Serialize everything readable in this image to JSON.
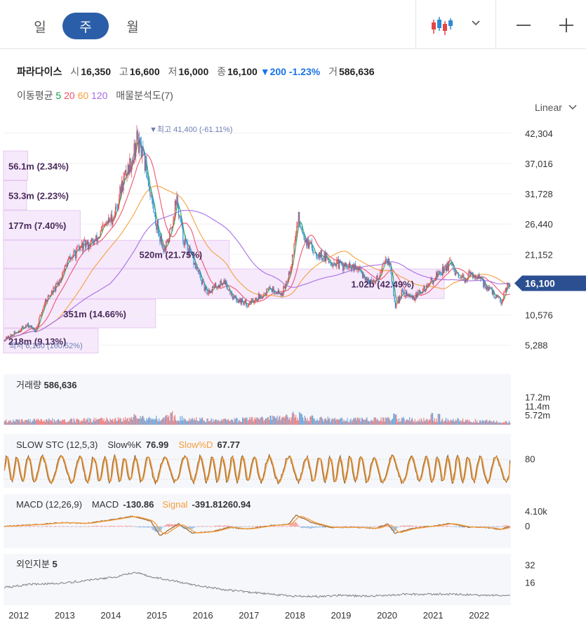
{
  "periods": {
    "day": "일",
    "week": "주",
    "month": "월"
  },
  "stock": {
    "name": "파라다이스",
    "open_label": "시",
    "open": "16,350",
    "high_label": "고",
    "high": "16,600",
    "low_label": "저",
    "low": "16,000",
    "close_label": "종",
    "close": "16,100",
    "change": "▼200",
    "change_pct": "-1.23%",
    "volume_label": "거",
    "volume": "586,636"
  },
  "ma_legend": {
    "label": "이동평균",
    "p5": "5",
    "p20": "20",
    "p60": "60",
    "p120": "120",
    "vp_label": "매물분석도(7)"
  },
  "scale_select": "Linear",
  "colors": {
    "up": "#e64545",
    "down": "#2d8bd4",
    "ma5": "#16a34a",
    "ma20": "#f0506e",
    "ma60": "#f59e3b",
    "ma120": "#a56be6",
    "accent": "#2b5ea8",
    "price_tag": "#2b4f91"
  },
  "icons": {
    "chart_type": "candlestick-icon",
    "dropdown": "chevron-down-icon",
    "zoom_out": "minus-icon",
    "zoom_in": "plus-icon"
  },
  "chart_data": [
    {
      "type": "candlestick",
      "y_ticks": [
        "42,304",
        "37,016",
        "31,728",
        "26,440",
        "21,152",
        "10,576",
        "5,288"
      ],
      "y_tick_values": [
        42304,
        37016,
        31728,
        26440,
        21152,
        10576,
        5288
      ],
      "ylim": [
        2800,
        43500
      ],
      "last_price": "16,100",
      "last_price_value": 16100,
      "annotations": {
        "high": "▼최고 41,400 (-61.11%)",
        "low": "최저 6,180 (160.52%)"
      },
      "volume_profile": [
        {
          "label": "218m (9.13%)",
          "price_from": 3800,
          "price_to": 8200,
          "pct": 9.13
        },
        {
          "label": "351m (14.66%)",
          "price_from": 8200,
          "price_to": 13300,
          "pct": 14.66
        },
        {
          "label": "1.02b (42.49%)",
          "price_from": 13300,
          "price_to": 18600,
          "pct": 42.49
        },
        {
          "label": "520m (21.75%)",
          "price_from": 18600,
          "price_to": 23600,
          "pct": 21.75
        },
        {
          "label": "177m (7.40%)",
          "price_from": 23600,
          "price_to": 28800,
          "pct": 7.4
        },
        {
          "label": "53.3m (2.23%)",
          "price_from": 28800,
          "price_to": 34000,
          "pct": 2.23
        },
        {
          "label": "56.1m (2.34%)",
          "price_from": 34000,
          "price_to": 39200,
          "pct": 2.34
        }
      ],
      "price_path": [
        [
          2011.7,
          6200
        ],
        [
          2011.95,
          7400
        ],
        [
          2012.2,
          8800
        ],
        [
          2012.4,
          7900
        ],
        [
          2012.6,
          13000
        ],
        [
          2012.85,
          15500
        ],
        [
          2013.1,
          20000
        ],
        [
          2013.4,
          22500
        ],
        [
          2013.7,
          23500
        ],
        [
          2013.9,
          26000
        ],
        [
          2014.1,
          28000
        ],
        [
          2014.3,
          34000
        ],
        [
          2014.5,
          38000
        ],
        [
          2014.6,
          41400
        ],
        [
          2014.8,
          36000
        ],
        [
          2015.0,
          27000
        ],
        [
          2015.2,
          21500
        ],
        [
          2015.35,
          26000
        ],
        [
          2015.45,
          31000
        ],
        [
          2015.6,
          24000
        ],
        [
          2015.9,
          18500
        ],
        [
          2016.1,
          14500
        ],
        [
          2016.3,
          15500
        ],
        [
          2016.5,
          16500
        ],
        [
          2016.7,
          13500
        ],
        [
          2017.0,
          12500
        ],
        [
          2017.3,
          14000
        ],
        [
          2017.5,
          15200
        ],
        [
          2017.75,
          14200
        ],
        [
          2017.95,
          19500
        ],
        [
          2018.1,
          27500
        ],
        [
          2018.3,
          23000
        ],
        [
          2018.5,
          21500
        ],
        [
          2018.8,
          20000
        ],
        [
          2019.1,
          19000
        ],
        [
          2019.4,
          18500
        ],
        [
          2019.7,
          16000
        ],
        [
          2019.9,
          18000
        ],
        [
          2020.0,
          21000
        ],
        [
          2020.1,
          19000
        ],
        [
          2020.2,
          12000
        ],
        [
          2020.35,
          14500
        ],
        [
          2020.6,
          13500
        ],
        [
          2020.9,
          15500
        ],
        [
          2021.1,
          17500
        ],
        [
          2021.4,
          19500
        ],
        [
          2021.6,
          16500
        ],
        [
          2021.9,
          17800
        ],
        [
          2022.2,
          15500
        ],
        [
          2022.5,
          12800
        ],
        [
          2022.65,
          16100
        ]
      ]
    },
    {
      "type": "bar",
      "title": "거래량",
      "value": "586,636",
      "y_ticks": [
        "17.2m",
        "11.4m",
        "5.72m"
      ],
      "y_tick_values": [
        17.2,
        11.4,
        5.72
      ],
      "ylim": [
        0,
        20
      ],
      "level": [
        [
          2011.7,
          0.25
        ],
        [
          2013.0,
          0.3
        ],
        [
          2014.3,
          0.38
        ],
        [
          2015.3,
          0.45
        ],
        [
          2016.5,
          0.28
        ],
        [
          2018.0,
          0.5
        ],
        [
          2019.0,
          0.32
        ],
        [
          2020.2,
          0.36
        ],
        [
          2021.2,
          0.33
        ],
        [
          2022.65,
          0.2
        ]
      ],
      "spikes": [
        [
          2014.55,
          0.75
        ],
        [
          2015.35,
          0.95
        ],
        [
          2018.0,
          0.85
        ],
        [
          2018.15,
          0.9
        ],
        [
          2020.2,
          0.7
        ],
        [
          2021.0,
          0.85
        ],
        [
          2021.15,
          0.7
        ]
      ]
    },
    {
      "type": "line",
      "title": "SLOW STC (12,5,3)",
      "k_label": "Slow%K",
      "k_value": "76.99",
      "d_label": "Slow%D",
      "d_value": "67.77",
      "y_ticks": [
        "80"
      ],
      "y_tick_values": [
        80
      ],
      "ylim": [
        0,
        100
      ]
    },
    {
      "type": "line",
      "title": "MACD (12,26,9)",
      "macd_label": "MACD",
      "macd_value": "-130.86",
      "signal_label": "Signal",
      "signal_value": "-391.81260.94",
      "y_ticks": [
        "4.10k",
        "0"
      ],
      "y_tick_values": [
        4100,
        0
      ],
      "ylim": [
        -5500,
        5500
      ],
      "macd_path": [
        [
          2011.7,
          0
        ],
        [
          2012.5,
          600
        ],
        [
          2013.0,
          1100
        ],
        [
          2013.5,
          900
        ],
        [
          2014.0,
          1800
        ],
        [
          2014.5,
          2900
        ],
        [
          2014.9,
          1500
        ],
        [
          2015.1,
          -2600
        ],
        [
          2015.3,
          -900
        ],
        [
          2015.5,
          800
        ],
        [
          2015.8,
          -1800
        ],
        [
          2016.2,
          -1500
        ],
        [
          2016.6,
          -200
        ],
        [
          2017.0,
          -700
        ],
        [
          2017.5,
          300
        ],
        [
          2017.9,
          700
        ],
        [
          2018.05,
          3200
        ],
        [
          2018.4,
          1100
        ],
        [
          2018.8,
          -300
        ],
        [
          2019.3,
          -200
        ],
        [
          2019.8,
          -500
        ],
        [
          2020.05,
          700
        ],
        [
          2020.2,
          -1900
        ],
        [
          2020.5,
          -700
        ],
        [
          2021.0,
          100
        ],
        [
          2021.4,
          900
        ],
        [
          2021.8,
          -200
        ],
        [
          2022.2,
          -300
        ],
        [
          2022.5,
          -800
        ],
        [
          2022.65,
          -130
        ]
      ]
    },
    {
      "type": "line",
      "title": "외인지분",
      "value": "5",
      "y_ticks": [
        "32",
        "16"
      ],
      "y_tick_values": [
        32,
        16
      ],
      "ylim": [
        -4,
        42
      ],
      "path": [
        [
          2011.7,
          12
        ],
        [
          2012.3,
          15
        ],
        [
          2013.0,
          16
        ],
        [
          2013.6,
          19
        ],
        [
          2014.2,
          22
        ],
        [
          2014.55,
          26
        ],
        [
          2014.9,
          22
        ],
        [
          2015.4,
          18
        ],
        [
          2015.9,
          14
        ],
        [
          2016.5,
          10
        ],
        [
          2017.0,
          8
        ],
        [
          2017.5,
          6
        ],
        [
          2018.0,
          4
        ],
        [
          2018.5,
          4
        ],
        [
          2019.0,
          5
        ],
        [
          2019.5,
          4
        ],
        [
          2020.0,
          5
        ],
        [
          2020.5,
          6
        ],
        [
          2021.0,
          6
        ],
        [
          2021.5,
          6
        ],
        [
          2022.0,
          5
        ],
        [
          2022.65,
          5
        ]
      ]
    }
  ],
  "x_axis": {
    "labels": [
      "2012",
      "2013",
      "2014",
      "2015",
      "2016",
      "2017",
      "2018",
      "2019",
      "2020",
      "2021",
      "2022"
    ],
    "values": [
      2012,
      2013,
      2014,
      2015,
      2016,
      2017,
      2018,
      2019,
      2020,
      2021,
      2022
    ]
  }
}
